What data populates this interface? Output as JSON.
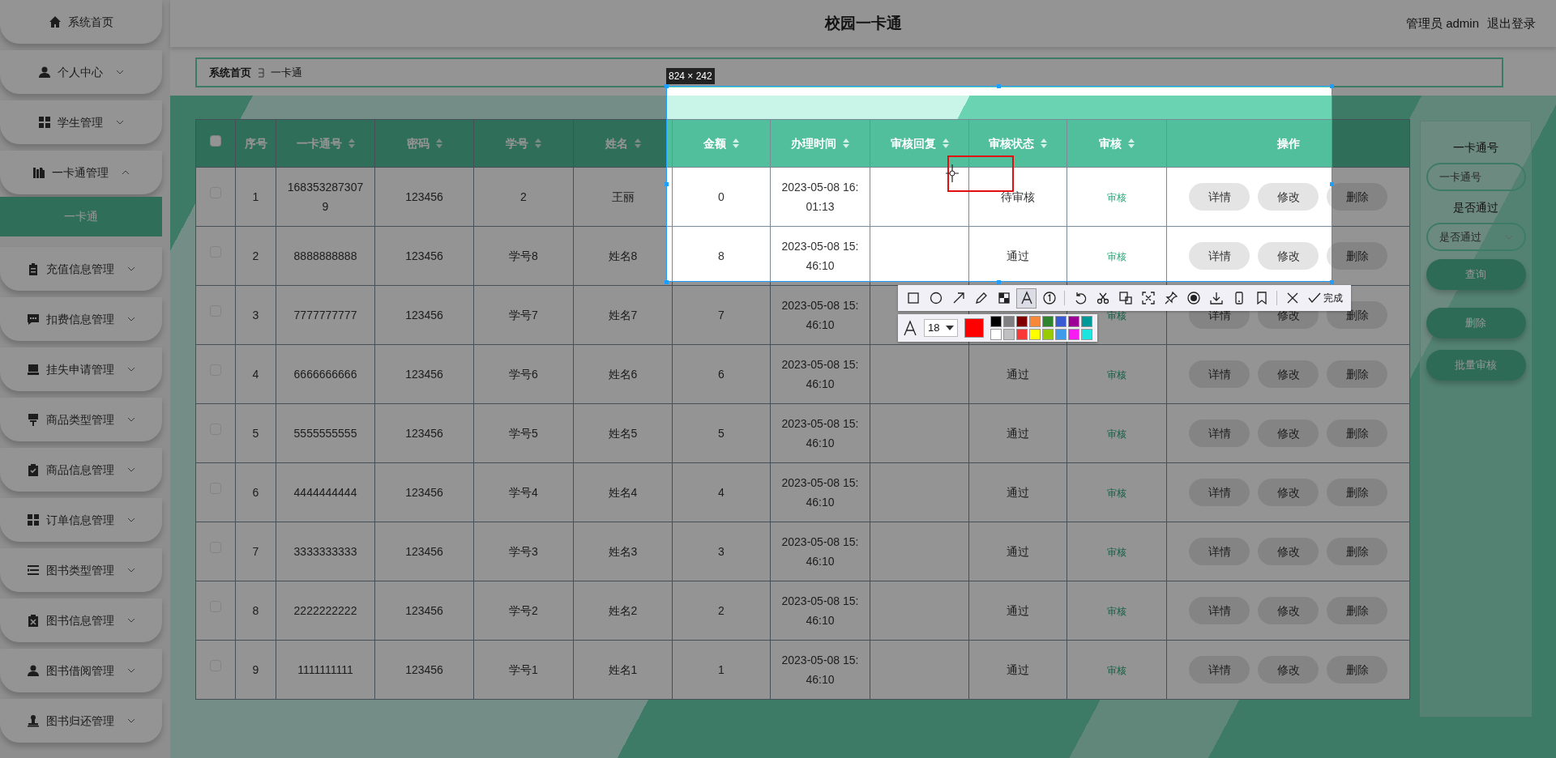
{
  "sidebar": {
    "items": [
      {
        "label": "系统首页"
      },
      {
        "label": "个人中心",
        "expanded": false
      },
      {
        "label": "学生管理",
        "expanded": false
      },
      {
        "label": "一卡通管理",
        "expanded": true,
        "children": [
          {
            "label": "一卡通",
            "selected": true
          }
        ]
      },
      {
        "label": "充值信息管理",
        "expanded": false
      },
      {
        "label": "扣费信息管理",
        "expanded": false
      },
      {
        "label": "挂失申请管理",
        "expanded": false
      },
      {
        "label": "商品类型管理",
        "expanded": false
      },
      {
        "label": "商品信息管理",
        "expanded": false
      },
      {
        "label": "订单信息管理",
        "expanded": false
      },
      {
        "label": "图书类型管理",
        "expanded": false
      },
      {
        "label": "图书信息管理",
        "expanded": false
      },
      {
        "label": "图书借阅管理",
        "expanded": false
      },
      {
        "label": "图书归还管理",
        "expanded": false
      }
    ]
  },
  "header": {
    "title": "校园一卡通",
    "user": "管理员 admin",
    "logout": "退出登录"
  },
  "breadcrumb": [
    "系统首页",
    "一卡通"
  ],
  "table": {
    "select_all": {
      "checked": false
    },
    "columns": [
      {
        "label": "序号",
        "sortable": false
      },
      {
        "label": "一卡通号",
        "sortable": true
      },
      {
        "label": "密码",
        "sortable": true
      },
      {
        "label": "学号",
        "sortable": true
      },
      {
        "label": "姓名",
        "sortable": true
      },
      {
        "label": "金额",
        "sortable": true
      },
      {
        "label": "办理时间",
        "sortable": true
      },
      {
        "label": "审核回复",
        "sortable": true
      },
      {
        "label": "审核状态",
        "sortable": true
      },
      {
        "label": "审核",
        "sortable": true
      },
      {
        "label": "操作",
        "sortable": false
      }
    ],
    "rows": [
      {
        "selected": false,
        "index": "1",
        "card_no": "1683532873079",
        "password": "123456",
        "student_no": "2",
        "name": "王丽",
        "amount": "0",
        "time": "2023-05-08 16:01:13",
        "status": "待审核",
        "review": "审核",
        "actions": [
          "详情",
          "修改",
          "删除"
        ]
      },
      {
        "selected": false,
        "index": "2",
        "card_no": "8888888888",
        "password": "123456",
        "student_no": "学号8",
        "name": "姓名8",
        "amount": "8",
        "time": "2023-05-08 15:46:10",
        "status": "通过",
        "review": "审核",
        "actions": [
          "详情",
          "修改",
          "删除"
        ]
      },
      {
        "selected": false,
        "index": "3",
        "card_no": "7777777777",
        "password": "123456",
        "student_no": "学号7",
        "name": "姓名7",
        "amount": "7",
        "time": "2023-05-08 15:46:10",
        "review": "审核",
        "actions": [
          "详情",
          "修改",
          "删除"
        ]
      },
      {
        "selected": false,
        "index": "4",
        "card_no": "6666666666",
        "password": "123456",
        "student_no": "学号6",
        "name": "姓名6",
        "amount": "6",
        "time": "2023-05-08 15:46:10",
        "status": "通过",
        "review": "审核",
        "actions": [
          "详情",
          "修改",
          "删除"
        ]
      },
      {
        "selected": false,
        "index": "5",
        "card_no": "5555555555",
        "password": "123456",
        "student_no": "学号5",
        "name": "姓名5",
        "amount": "5",
        "time": "2023-05-08 15:46:10",
        "status": "通过",
        "review": "审核",
        "actions": [
          "详情",
          "修改",
          "删除"
        ]
      },
      {
        "selected": false,
        "index": "6",
        "card_no": "4444444444",
        "password": "123456",
        "student_no": "学号4",
        "name": "姓名4",
        "amount": "4",
        "time": "2023-05-08 15:46:10",
        "status": "通过",
        "review": "审核",
        "actions": [
          "详情",
          "修改",
          "删除"
        ]
      },
      {
        "selected": false,
        "index": "7",
        "card_no": "3333333333",
        "password": "123456",
        "student_no": "学号3",
        "name": "姓名3",
        "amount": "3",
        "time": "2023-05-08 15:46:10",
        "status": "通过",
        "review": "审核",
        "actions": [
          "详情",
          "修改",
          "删除"
        ]
      },
      {
        "selected": false,
        "index": "8",
        "card_no": "2222222222",
        "password": "123456",
        "student_no": "学号2",
        "name": "姓名2",
        "amount": "2",
        "time": "2023-05-08 15:46:10",
        "status": "通过",
        "review": "审核",
        "actions": [
          "详情",
          "修改",
          "删除"
        ]
      },
      {
        "selected": false,
        "index": "9",
        "card_no": "1111111111",
        "password": "123456",
        "student_no": "学号1",
        "name": "姓名1",
        "amount": "1",
        "time": "2023-05-08 15:46:10",
        "status": "通过",
        "review": "审核",
        "actions": [
          "详情",
          "修改",
          "删除"
        ]
      }
    ]
  },
  "filters": {
    "fields": [
      {
        "kind": "input",
        "label": "一卡通号",
        "placeholder": "一卡通号"
      },
      {
        "kind": "select",
        "label": "是否通过",
        "placeholder": "是否通过"
      }
    ],
    "buttons": [
      "查询",
      "删除",
      "批量审核"
    ]
  },
  "capture": {
    "size_label": "824 × 242",
    "tools": [
      {
        "selected": false
      },
      {
        "selected": false
      },
      {
        "selected": false
      },
      {
        "selected": false
      },
      {
        "selected": false
      },
      {
        "selected": true
      },
      {
        "selected": false
      }
    ],
    "finish": "完成",
    "font_size": "18",
    "color": "#ff0000",
    "palette": [
      {
        "color": "#000000"
      },
      {
        "color": "#808080"
      },
      {
        "color": "#800000"
      },
      {
        "color": "#f7883a"
      },
      {
        "color": "#308430"
      },
      {
        "color": "#385ad3"
      },
      {
        "color": "#9c0097"
      },
      {
        "color": "#009999"
      },
      {
        "color": "#ffffff"
      },
      {
        "color": "#c0c0c0"
      },
      {
        "color": "#fb3838"
      },
      {
        "color": "#ffff00"
      },
      {
        "color": "#99cc00"
      },
      {
        "color": "#3d9be9"
      },
      {
        "color": "#f81cf2"
      },
      {
        "color": "#1ce4de"
      }
    ]
  }
}
